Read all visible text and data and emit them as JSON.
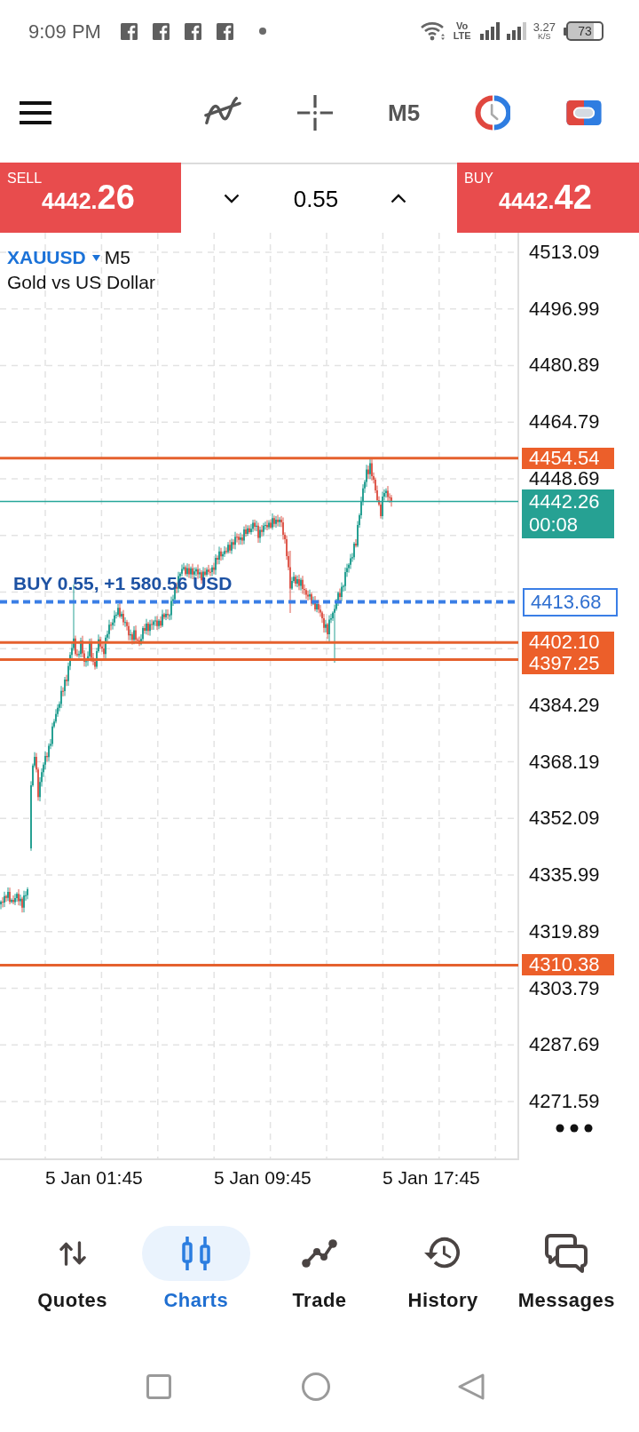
{
  "status_bar": {
    "time": "9:09 PM",
    "notifications": [
      {
        "kind": "facebook"
      },
      {
        "kind": "facebook"
      },
      {
        "kind": "facebook"
      },
      {
        "kind": "facebook"
      },
      {
        "kind": "dot"
      }
    ],
    "volte_top": "Vo",
    "volte_bottom": "LTE",
    "speed": "3.27",
    "speed_unit": "K/S",
    "battery": "73"
  },
  "toolbar": {
    "timeframe": "M5"
  },
  "trade_panel": {
    "sell": {
      "label": "SELL",
      "price_small": "4442.",
      "price_large": "26"
    },
    "volume": "0.55",
    "buy": {
      "label": "BUY",
      "price_small": "4442.",
      "price_large": "42"
    }
  },
  "chart": {
    "symbol": "XAUUSD",
    "timeframe": "M5",
    "description": "Gold vs US Dollar",
    "price_ticks": [
      "4513.09",
      "4496.99",
      "4480.89",
      "4464.79",
      "4448.69",
      "4384.29",
      "4368.19",
      "4352.09",
      "4335.99",
      "4319.89",
      "4303.79",
      "4287.69",
      "4271.59"
    ],
    "time_ticks": [
      "5 Jan 01:45",
      "5 Jan 09:45",
      "5 Jan 17:45"
    ],
    "price_lines": [
      {
        "kind": "level",
        "label": "4454.54"
      },
      {
        "kind": "bid",
        "label": "4442.26",
        "timer": "00:08"
      },
      {
        "kind": "position",
        "label": "4413.68",
        "text": "BUY 0.55, +1 580.56 USD"
      },
      {
        "kind": "level",
        "label": "4402.10"
      },
      {
        "kind": "level",
        "label": "4397.25"
      },
      {
        "kind": "level",
        "label": "4310.38"
      }
    ]
  },
  "bottom_nav": [
    {
      "label": "Quotes",
      "selected": false
    },
    {
      "label": "Charts",
      "selected": true
    },
    {
      "label": "Trade",
      "selected": false
    },
    {
      "label": "History",
      "selected": false
    },
    {
      "label": "Messages",
      "selected": false
    }
  ]
}
